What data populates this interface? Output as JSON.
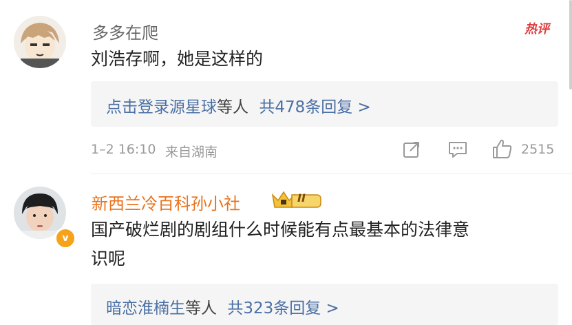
{
  "comments": [
    {
      "username": "多多在爬",
      "text": "刘浩存啊，她是这样的",
      "hot_label": "热评",
      "reply": {
        "user_link": "点击登录源星球",
        "others": "等人",
        "total_link": "共478条回复 >"
      },
      "time": "1–2 16:10",
      "location": "来自湖南",
      "likes": "2515"
    },
    {
      "username": "新西兰冷百科孙小社",
      "vip_level": "II",
      "verified_mark": "v",
      "text_line1": "国产破烂剧的剧组什么时候能有点最基本的法律意",
      "text_line2": "识呢",
      "reply": {
        "user_link": "暗恋淮楠生",
        "others": "等人",
        "total_link": "共323条回复 >"
      }
    }
  ],
  "icons": {
    "share": "share-icon",
    "comment": "comment-icon",
    "like": "thumbs-up-icon"
  },
  "colors": {
    "link": "#4a6fa5",
    "vip_name": "#e8731f",
    "hot": "#e03c3c"
  }
}
